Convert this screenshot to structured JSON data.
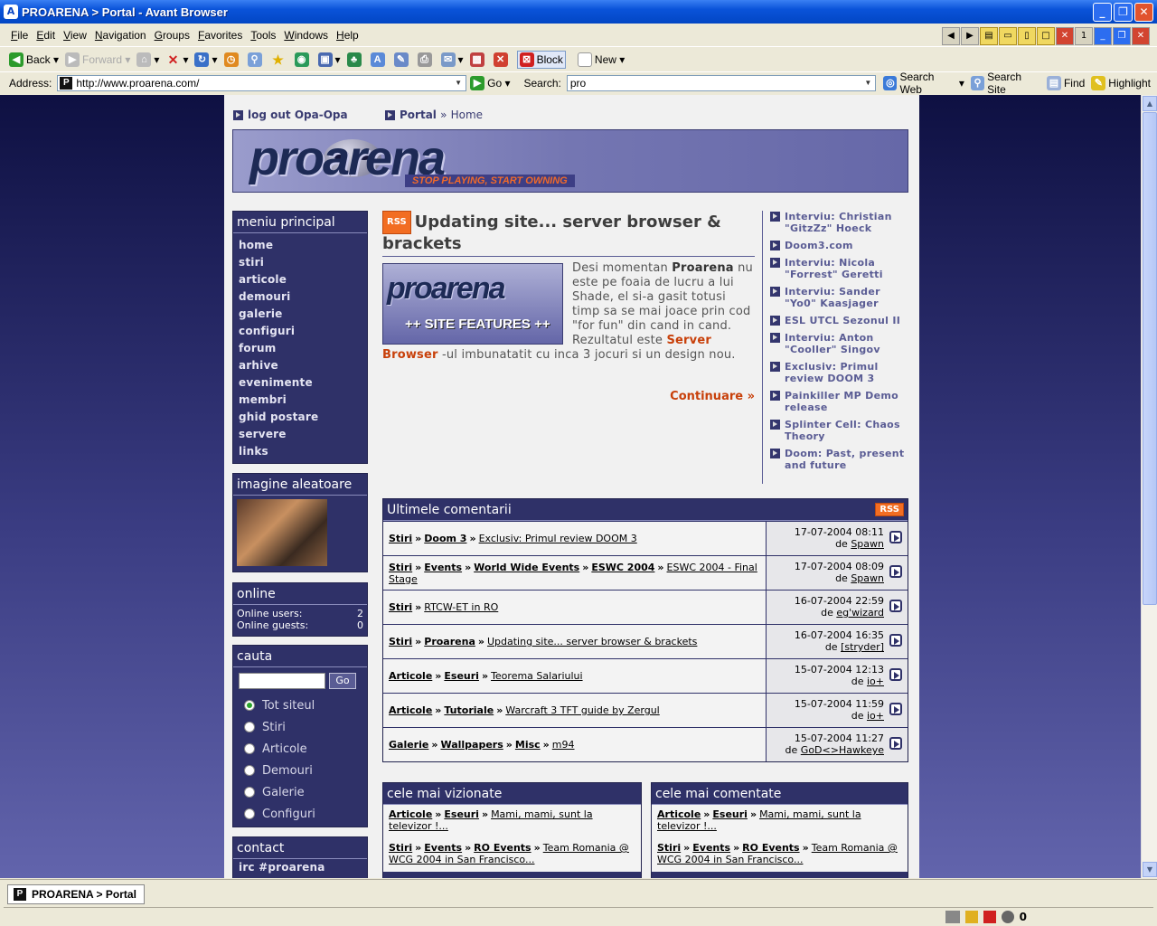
{
  "window": {
    "title": "PROARENA  > Portal - Avant Browser"
  },
  "menubar": [
    "File",
    "Edit",
    "View",
    "Navigation",
    "Groups",
    "Favorites",
    "Tools",
    "Windows",
    "Help"
  ],
  "toolbar": {
    "back": "Back",
    "forward": "Forward",
    "block": "Block",
    "new": "New"
  },
  "addressbar": {
    "label": "Address:",
    "url": "http://www.proarena.com/",
    "go": "Go",
    "search_label": "Search:",
    "search_value": "pro",
    "search_web": "Search Web",
    "search_site": "Search Site",
    "find": "Find",
    "highlight": "Highlight"
  },
  "page": {
    "logout": "log out Opa-Opa",
    "breadcrumb": {
      "portal": "Portal",
      "sep": "»",
      "home": "Home"
    },
    "banner": {
      "logo": "proarena",
      "tagline": "STOP PLAYING, START OWNING"
    },
    "menu": {
      "title": "meniu principal",
      "items": [
        "home",
        "stiri",
        "articole",
        "demouri",
        "galerie",
        "configuri",
        "forum",
        "arhive",
        "evenimente",
        "membri",
        "ghid postare",
        "servere",
        "links"
      ]
    },
    "random_image": {
      "title": "imagine aleatoare"
    },
    "online": {
      "title": "online",
      "users_label": "Online users:",
      "users": "2",
      "guests_label": "Online guests:",
      "guests": "0"
    },
    "search": {
      "title": "cauta",
      "button": "Go",
      "options": [
        "Tot siteul",
        "Stiri",
        "Articole",
        "Demouri",
        "Galerie",
        "Configuri"
      ]
    },
    "contact": {
      "title": "contact",
      "irc": "irc #proarena"
    },
    "article": {
      "rss": "RSS",
      "title": "Updating site... server browser & brackets",
      "image_line1": "proarena",
      "image_line2": "++ SITE FEATURES ++",
      "p1": "Desi momentan ",
      "b1": "Proarena",
      "p2": " nu este pe foaia de lucru a lui Shade, el si-a gasit totusi timp sa se mai joace prin cod \"for fun\" din cand in cand. Rezultatul este ",
      "hl": "Server Browser",
      "p3": " -ul imbunatatit cu inca 3 jocuri si un design nou.",
      "continue": "Continuare »"
    },
    "side_links": [
      "Interviu: Christian \"GitzZz\" Hoeck",
      "Doom3.com",
      "Interviu: Nicola \"Forrest\" Geretti",
      "Interviu: Sander \"Yo0\" Kaasjager",
      "ESL UTCL Sezonul II",
      "Interviu: Anton \"Cooller\" Singov",
      "Exclusiv: Primul review DOOM 3",
      "Painkiller MP Demo release",
      "Splinter Cell: Chaos Theory",
      "Doom: Past, present and future"
    ],
    "comments": {
      "title": "Ultimele comentarii",
      "rss": "RSS",
      "rows": [
        {
          "path": [
            "Stiri",
            "Doom 3"
          ],
          "link": "Exclusiv: Primul review DOOM 3",
          "date": "17-07-2004 08:11",
          "by": "de",
          "author": "Spawn"
        },
        {
          "path": [
            "Stiri",
            "Events",
            "World Wide Events",
            "ESWC 2004"
          ],
          "link": "ESWC 2004 - Final Stage",
          "date": "17-07-2004 08:09",
          "by": "de",
          "author": "Spawn"
        },
        {
          "path": [
            "Stiri"
          ],
          "link": "RTCW-ET in RO",
          "date": "16-07-2004 22:59",
          "by": "de",
          "author": "eg'wizard"
        },
        {
          "path": [
            "Stiri",
            "Proarena"
          ],
          "link": "Updating site... server browser & brackets",
          "date": "16-07-2004 16:35",
          "by": "de",
          "author": "[stryder]"
        },
        {
          "path": [
            "Articole",
            "Eseuri"
          ],
          "link": "Teorema Salariului",
          "date": "15-07-2004 12:13",
          "by": "de",
          "author": "io+"
        },
        {
          "path": [
            "Articole",
            "Tutoriale"
          ],
          "link": "Warcraft 3 TFT guide by Zergul",
          "date": "15-07-2004 11:59",
          "by": "de",
          "author": "io+"
        },
        {
          "path": [
            "Galerie",
            "Wallpapers",
            "Misc"
          ],
          "link": "m94",
          "date": "15-07-2004 11:27",
          "by": "de",
          "author": "GoD<>Hawkeye"
        }
      ]
    },
    "most_viewed": {
      "title": "cele mai vizionate",
      "items": [
        {
          "path": [
            "Articole",
            "Eseuri"
          ],
          "link": "Mami, mami, sunt la televizor !..."
        },
        {
          "path": [
            "Stiri",
            "Events",
            "RO Events"
          ],
          "link": "Team Romania @ WCG 2004 in San Francisco..."
        }
      ]
    },
    "most_commented": {
      "title": "cele mai comentate",
      "items": [
        {
          "path": [
            "Articole",
            "Eseuri"
          ],
          "link": "Mami, mami, sunt la televizor !..."
        },
        {
          "path": [
            "Stiri",
            "Events",
            "RO Events"
          ],
          "link": "Team Romania @ WCG 2004 in San Francisco..."
        }
      ]
    }
  },
  "status": {
    "tab": "PROARENA > Portal",
    "count": "0"
  }
}
